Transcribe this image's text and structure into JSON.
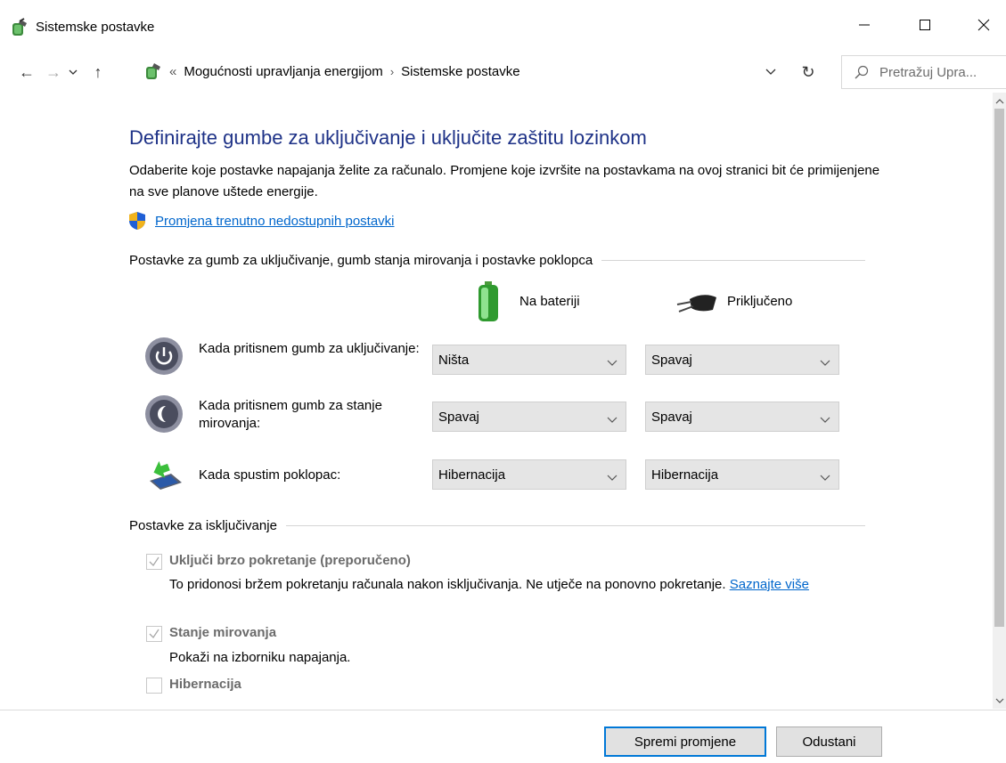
{
  "window": {
    "title": "Sistemske postavke",
    "controls": [
      "minimize-icon",
      "maximize-icon",
      "close-icon"
    ]
  },
  "address": {
    "prefix": "«",
    "breadcrumb": [
      "Mogućnosti upravljanja energijom",
      "Sistemske postavke"
    ],
    "separator": "›",
    "search_placeholder": "Pretražuj Upra..."
  },
  "main": {
    "heading": "Definirajte gumbe za uključivanje i uključite zaštitu lozinkom",
    "description": "Odaberite koje postavke napajanja želite za računalo. Promjene koje izvršite na postavkama na ovoj stranici bit će primijenjene na sve planove uštede energije.",
    "change_link": "Promjena trenutno nedostupnih postavki",
    "buttons_group_title": "Postavke za gumb za uključivanje, gumb stanja mirovanja i postavke poklopca",
    "col_battery": "Na bateriji",
    "col_plugged": "Priključeno",
    "rows": [
      {
        "label": "Kada pritisnem gumb za uključivanje:",
        "battery": "Ništa",
        "plugged": "Spavaj",
        "icon": "power-button-icon"
      },
      {
        "label": "Kada pritisnem gumb za stanje mirovanja:",
        "battery": "Spavaj",
        "plugged": "Spavaj",
        "icon": "sleep-button-icon"
      },
      {
        "label": "Kada spustim poklopac:",
        "battery": "Hibernacija",
        "plugged": "Hibernacija",
        "icon": "laptop-lid-icon"
      }
    ],
    "shutdown_group_title": "Postavke za isključivanje",
    "shutdown": [
      {
        "label": "Uključi brzo pokretanje (preporučeno)",
        "checked": true,
        "desc": "To pridonosi bržem pokretanju računala nakon isključivanja. Ne utječe na ponovno pokretanje.",
        "link": "Saznajte više"
      },
      {
        "label": "Stanje mirovanja",
        "checked": true,
        "desc": "Pokaži na izborniku napajanja."
      },
      {
        "label": "Hibernacija",
        "checked": false
      }
    ]
  },
  "footer": {
    "save": "Spremi promjene",
    "cancel": "Odustani"
  },
  "colors": {
    "heading": "#1e3287",
    "link": "#0066cc",
    "primary_border": "#0078d7"
  }
}
